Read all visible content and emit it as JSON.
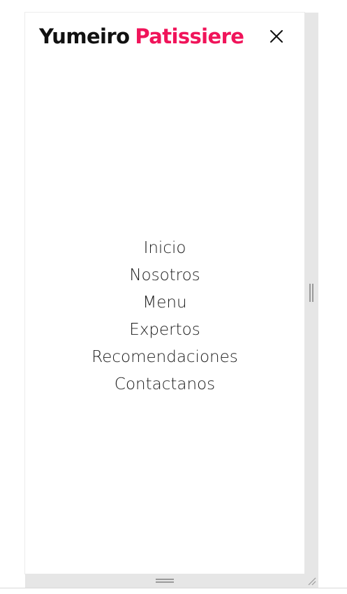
{
  "brand": {
    "part1": "Yumeiro",
    "part2": "Patissiere",
    "accent_color": "#f0145a",
    "text_color": "#111111"
  },
  "header": {
    "close_icon": "close-icon"
  },
  "nav": {
    "items": [
      {
        "label": "Inicio"
      },
      {
        "label": "Nosotros"
      },
      {
        "label": "Menu"
      },
      {
        "label": "Expertos"
      },
      {
        "label": "Recomendaciones"
      },
      {
        "label": "Contactanos"
      }
    ]
  },
  "resize_handles": {
    "right_icon": "vertical-grip-icon",
    "bottom_icon": "horizontal-grip-icon",
    "corner_icon": "resize-corner-icon"
  }
}
